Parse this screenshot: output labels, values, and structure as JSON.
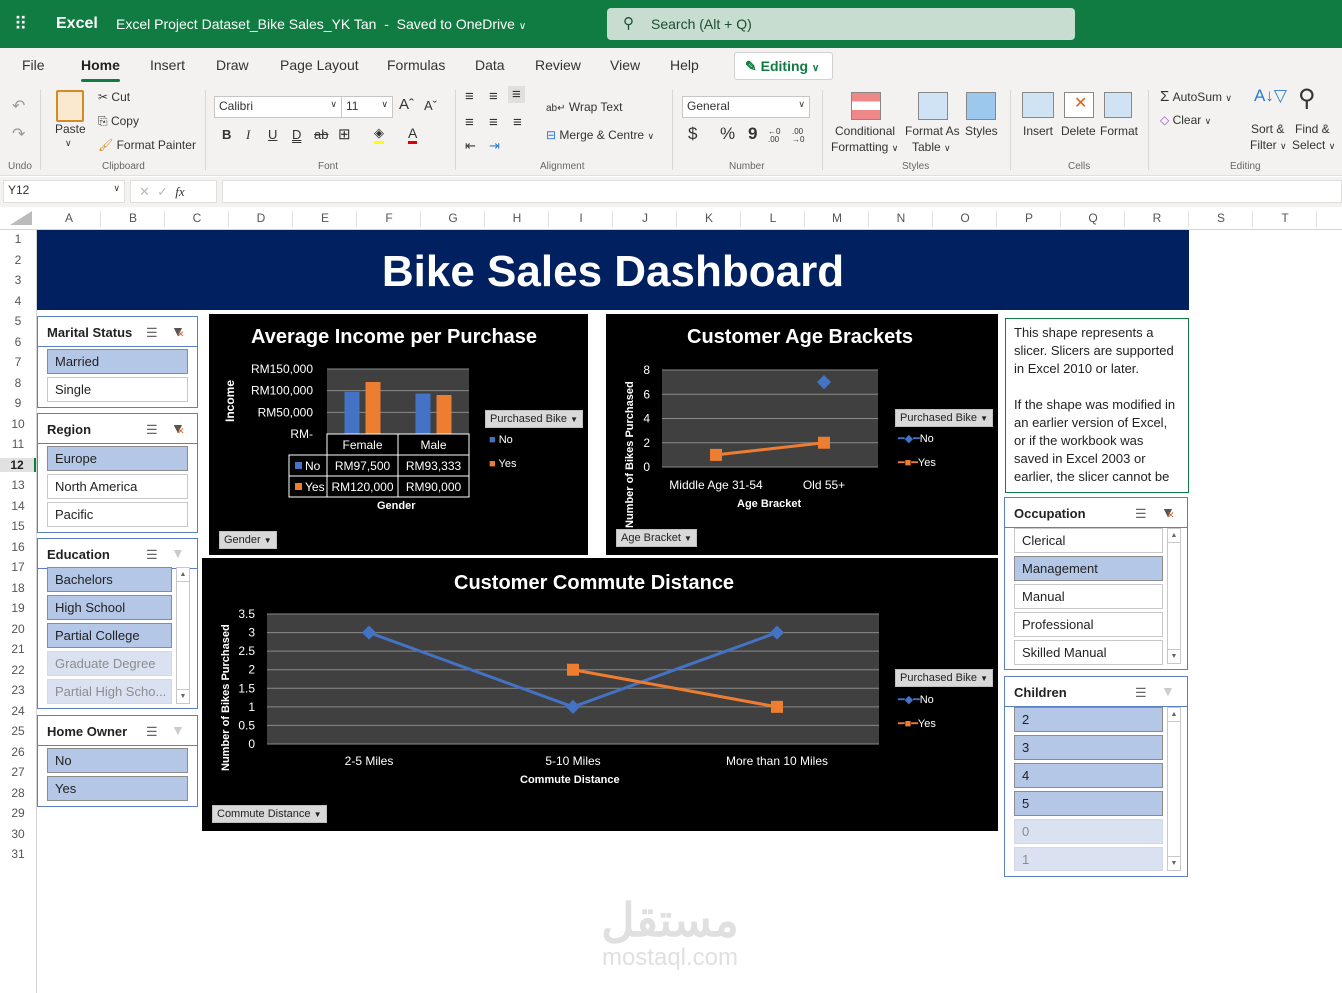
{
  "titlebar": {
    "app": "Excel",
    "document": "Excel Project Dataset_Bike Sales_YK Tan",
    "save_status": "Saved to OneDrive",
    "search_placeholder": "Search (Alt + Q)"
  },
  "menu": {
    "tabs": [
      "File",
      "Home",
      "Insert",
      "Draw",
      "Page Layout",
      "Formulas",
      "Data",
      "Review",
      "View",
      "Help"
    ],
    "active": "Home",
    "mode": "Editing"
  },
  "ribbon": {
    "undo_group": "Undo",
    "clipboard": {
      "paste": "Paste",
      "cut": "Cut",
      "copy": "Copy",
      "format_painter": "Format Painter",
      "group": "Clipboard"
    },
    "font": {
      "name": "Calibri",
      "size": "11",
      "group": "Font",
      "bold": "B",
      "italic": "I",
      "underline": "U",
      "double_underline": "D",
      "strike": "ab"
    },
    "alignment": {
      "wrap": "Wrap Text",
      "merge": "Merge & Centre",
      "group": "Alignment"
    },
    "number": {
      "format": "General",
      "currency": "$",
      "percent": "%",
      "comma": "9",
      "inc": "←0 .00",
      "dec": ".00 →0",
      "group": "Number"
    },
    "styles": {
      "conditional": "Conditional",
      "conditional2": "Formatting",
      "format_table": "Format As",
      "format_table2": "Table",
      "styles": "Styles",
      "group": "Styles"
    },
    "cells": {
      "insert": "Insert",
      "delete": "Delete",
      "format": "Format",
      "group": "Cells"
    },
    "editing": {
      "autosum": "AutoSum",
      "clear": "Clear",
      "sort": "Sort &",
      "sort2": "Filter",
      "find": "Find &",
      "find2": "Select",
      "group": "Editing"
    }
  },
  "formula_bar": {
    "name_box": "Y12",
    "fx": "fx",
    "value": ""
  },
  "columns": [
    "A",
    "B",
    "C",
    "D",
    "E",
    "F",
    "G",
    "H",
    "I",
    "J",
    "K",
    "L",
    "M",
    "N",
    "O",
    "P",
    "Q",
    "R",
    "S",
    "T"
  ],
  "rows": [
    "1",
    "2",
    "3",
    "4",
    "5",
    "6",
    "7",
    "8",
    "9",
    "10",
    "11",
    "12",
    "13",
    "14",
    "15",
    "16",
    "17",
    "18",
    "19",
    "20",
    "21",
    "22",
    "23",
    "24",
    "25",
    "26",
    "27",
    "28",
    "29",
    "30",
    "31"
  ],
  "active_row": "12",
  "dashboard": {
    "title": "Bike Sales Dashboard"
  },
  "slicers": {
    "marital": {
      "title": "Marital Status",
      "items": [
        {
          "label": "Married",
          "state": "selected"
        },
        {
          "label": "Single",
          "state": "normal"
        }
      ]
    },
    "region": {
      "title": "Region",
      "items": [
        {
          "label": "Europe",
          "state": "selected"
        },
        {
          "label": "North America",
          "state": "normal"
        },
        {
          "label": "Pacific",
          "state": "normal"
        }
      ]
    },
    "education": {
      "title": "Education",
      "items": [
        {
          "label": "Bachelors",
          "state": "selected"
        },
        {
          "label": "High School",
          "state": "selected"
        },
        {
          "label": "Partial College",
          "state": "selected"
        },
        {
          "label": "Graduate Degree",
          "state": "nodata"
        },
        {
          "label": "Partial High Scho...",
          "state": "nodata"
        }
      ]
    },
    "home_owner": {
      "title": "Home Owner",
      "items": [
        {
          "label": "No",
          "state": "selected"
        },
        {
          "label": "Yes",
          "state": "selected"
        }
      ]
    },
    "occupation": {
      "title": "Occupation",
      "items": [
        {
          "label": "Clerical",
          "state": "normal"
        },
        {
          "label": "Management",
          "state": "selected"
        },
        {
          "label": "Manual",
          "state": "normal"
        },
        {
          "label": "Professional",
          "state": "normal"
        },
        {
          "label": "Skilled Manual",
          "state": "normal"
        }
      ]
    },
    "children": {
      "title": "Children",
      "items": [
        {
          "label": "2",
          "state": "selected"
        },
        {
          "label": "3",
          "state": "selected"
        },
        {
          "label": "4",
          "state": "selected"
        },
        {
          "label": "5",
          "state": "selected"
        },
        {
          "label": "0",
          "state": "nodata"
        },
        {
          "label": "1",
          "state": "nodata"
        }
      ]
    }
  },
  "note": {
    "p1": "This shape represents a slicer. Slicers are supported in Excel 2010 or later.",
    "p2": "If the shape was modified in an earlier version of Excel, or if the workbook was saved in Excel 2003 or earlier, the slicer cannot be"
  },
  "colors": {
    "no": "#4472c4",
    "yes": "#ed7d31",
    "banner": "#002060",
    "excel_green": "#107c41",
    "slicer_selected": "#b4c7e7"
  },
  "chart_data": [
    {
      "type": "bar",
      "title": "Average Income per Purchase",
      "xlabel": "Gender",
      "ylabel": "Income",
      "categories": [
        "Female",
        "Male"
      ],
      "ylim": [
        0,
        150000
      ],
      "yticks": [
        "RM-",
        "RM50,000",
        "RM100,000",
        "RM150,000"
      ],
      "ytick_values": [
        0,
        50000,
        100000,
        150000
      ],
      "series": [
        {
          "name": "No",
          "values": [
            97500,
            93333
          ],
          "labels": [
            "RM97,500",
            "RM93,333"
          ]
        },
        {
          "name": "Yes",
          "values": [
            120000,
            90000
          ],
          "labels": [
            "RM120,000",
            "RM90,000"
          ]
        }
      ],
      "legend_title": "Purchased Bike",
      "legend": "right",
      "filter_button": "Gender",
      "data_table": true
    },
    {
      "type": "line",
      "title": "Customer Age Brackets",
      "xlabel": "Age Bracket",
      "ylabel": "Number of Bikes Purchased",
      "categories": [
        "Middle Age 31-54",
        "Old 55+"
      ],
      "ylim": [
        0,
        8
      ],
      "yticks": [
        0,
        2,
        4,
        6,
        8
      ],
      "series": [
        {
          "name": "No",
          "values": [
            null,
            7
          ]
        },
        {
          "name": "Yes",
          "values": [
            1,
            2
          ]
        }
      ],
      "legend_title": "Purchased Bike",
      "legend": "right",
      "filter_button": "Age Bracket"
    },
    {
      "type": "line",
      "title": "Customer Commute Distance",
      "xlabel": "Commute Distance",
      "ylabel": "Number of Bikes Purchased",
      "categories": [
        "2-5 Miles",
        "5-10 Miles",
        "More than 10 Miles"
      ],
      "ylim": [
        0,
        3.5
      ],
      "yticks": [
        0,
        0.5,
        1,
        1.5,
        2,
        2.5,
        3,
        3.5
      ],
      "series": [
        {
          "name": "No",
          "values": [
            3,
            1,
            3
          ]
        },
        {
          "name": "Yes",
          "values": [
            null,
            2,
            1
          ]
        }
      ],
      "legend_title": "Purchased Bike",
      "legend": "right",
      "filter_button": "Commute Distance"
    }
  ],
  "watermark": {
    "arabic": "مستقل",
    "latin": "mostaql.com"
  }
}
